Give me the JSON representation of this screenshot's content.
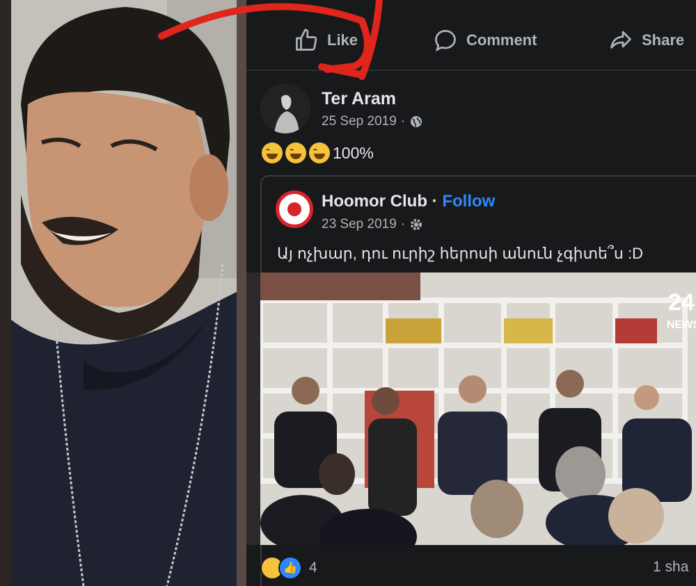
{
  "actions": {
    "like": "Like",
    "comment": "Comment",
    "share": "Share"
  },
  "post": {
    "author": "Ter Aram",
    "date": "25 Sep 2019",
    "privacy_icon": "globe-icon",
    "text": "100%",
    "emojis": [
      "laughing-emoji",
      "laughing-emoji",
      "laughing-emoji"
    ]
  },
  "shared_post": {
    "page_name": "Hoomor Club",
    "separator": "·",
    "follow_label": "Follow",
    "date": "23 Sep 2019",
    "privacy_icon": "settings-icon",
    "text": "Այ ոչխար, դու ուրիշ հերոսի անուն չգիտե՞ս :D"
  },
  "video": {
    "watermark_number": "24",
    "watermark_label": "NEWS"
  },
  "reactions": {
    "count": "4",
    "shares": "1 sha"
  },
  "colors": {
    "accent": "#2d88ff",
    "background": "#18191a",
    "annotation_arrow": "#e0261c"
  }
}
